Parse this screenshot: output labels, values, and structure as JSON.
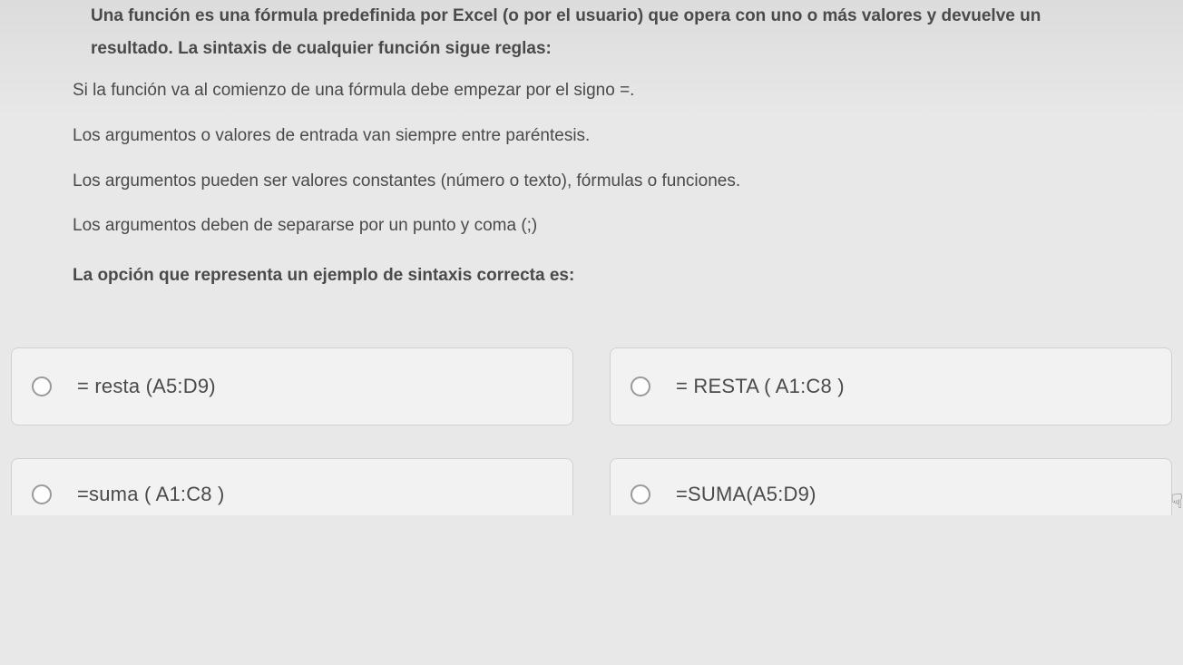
{
  "question": {
    "intro": "Una función es una fórmula predefinida por Excel (o por el usuario) que opera con uno o más valores y devuelve un resultado. La sintaxis de cualquier función sigue reglas:",
    "rules": [
      "Si la función va al comienzo de una fórmula debe empezar por el signo =.",
      "Los argumentos o valores de entrada van siempre entre paréntesis.",
      "Los argumentos pueden ser valores constantes (número o texto), fórmulas o funciones.",
      "Los argumentos deben de separarse por un punto y coma (;)"
    ],
    "prompt": "La opción que representa un ejemplo de sintaxis correcta es:"
  },
  "options": [
    {
      "label": "= resta (A5:D9)"
    },
    {
      "label": "= RESTA ( A1:C8 )"
    },
    {
      "label": "=suma ( A1:C8 )"
    },
    {
      "label": "=SUMA(A5:D9)"
    }
  ]
}
